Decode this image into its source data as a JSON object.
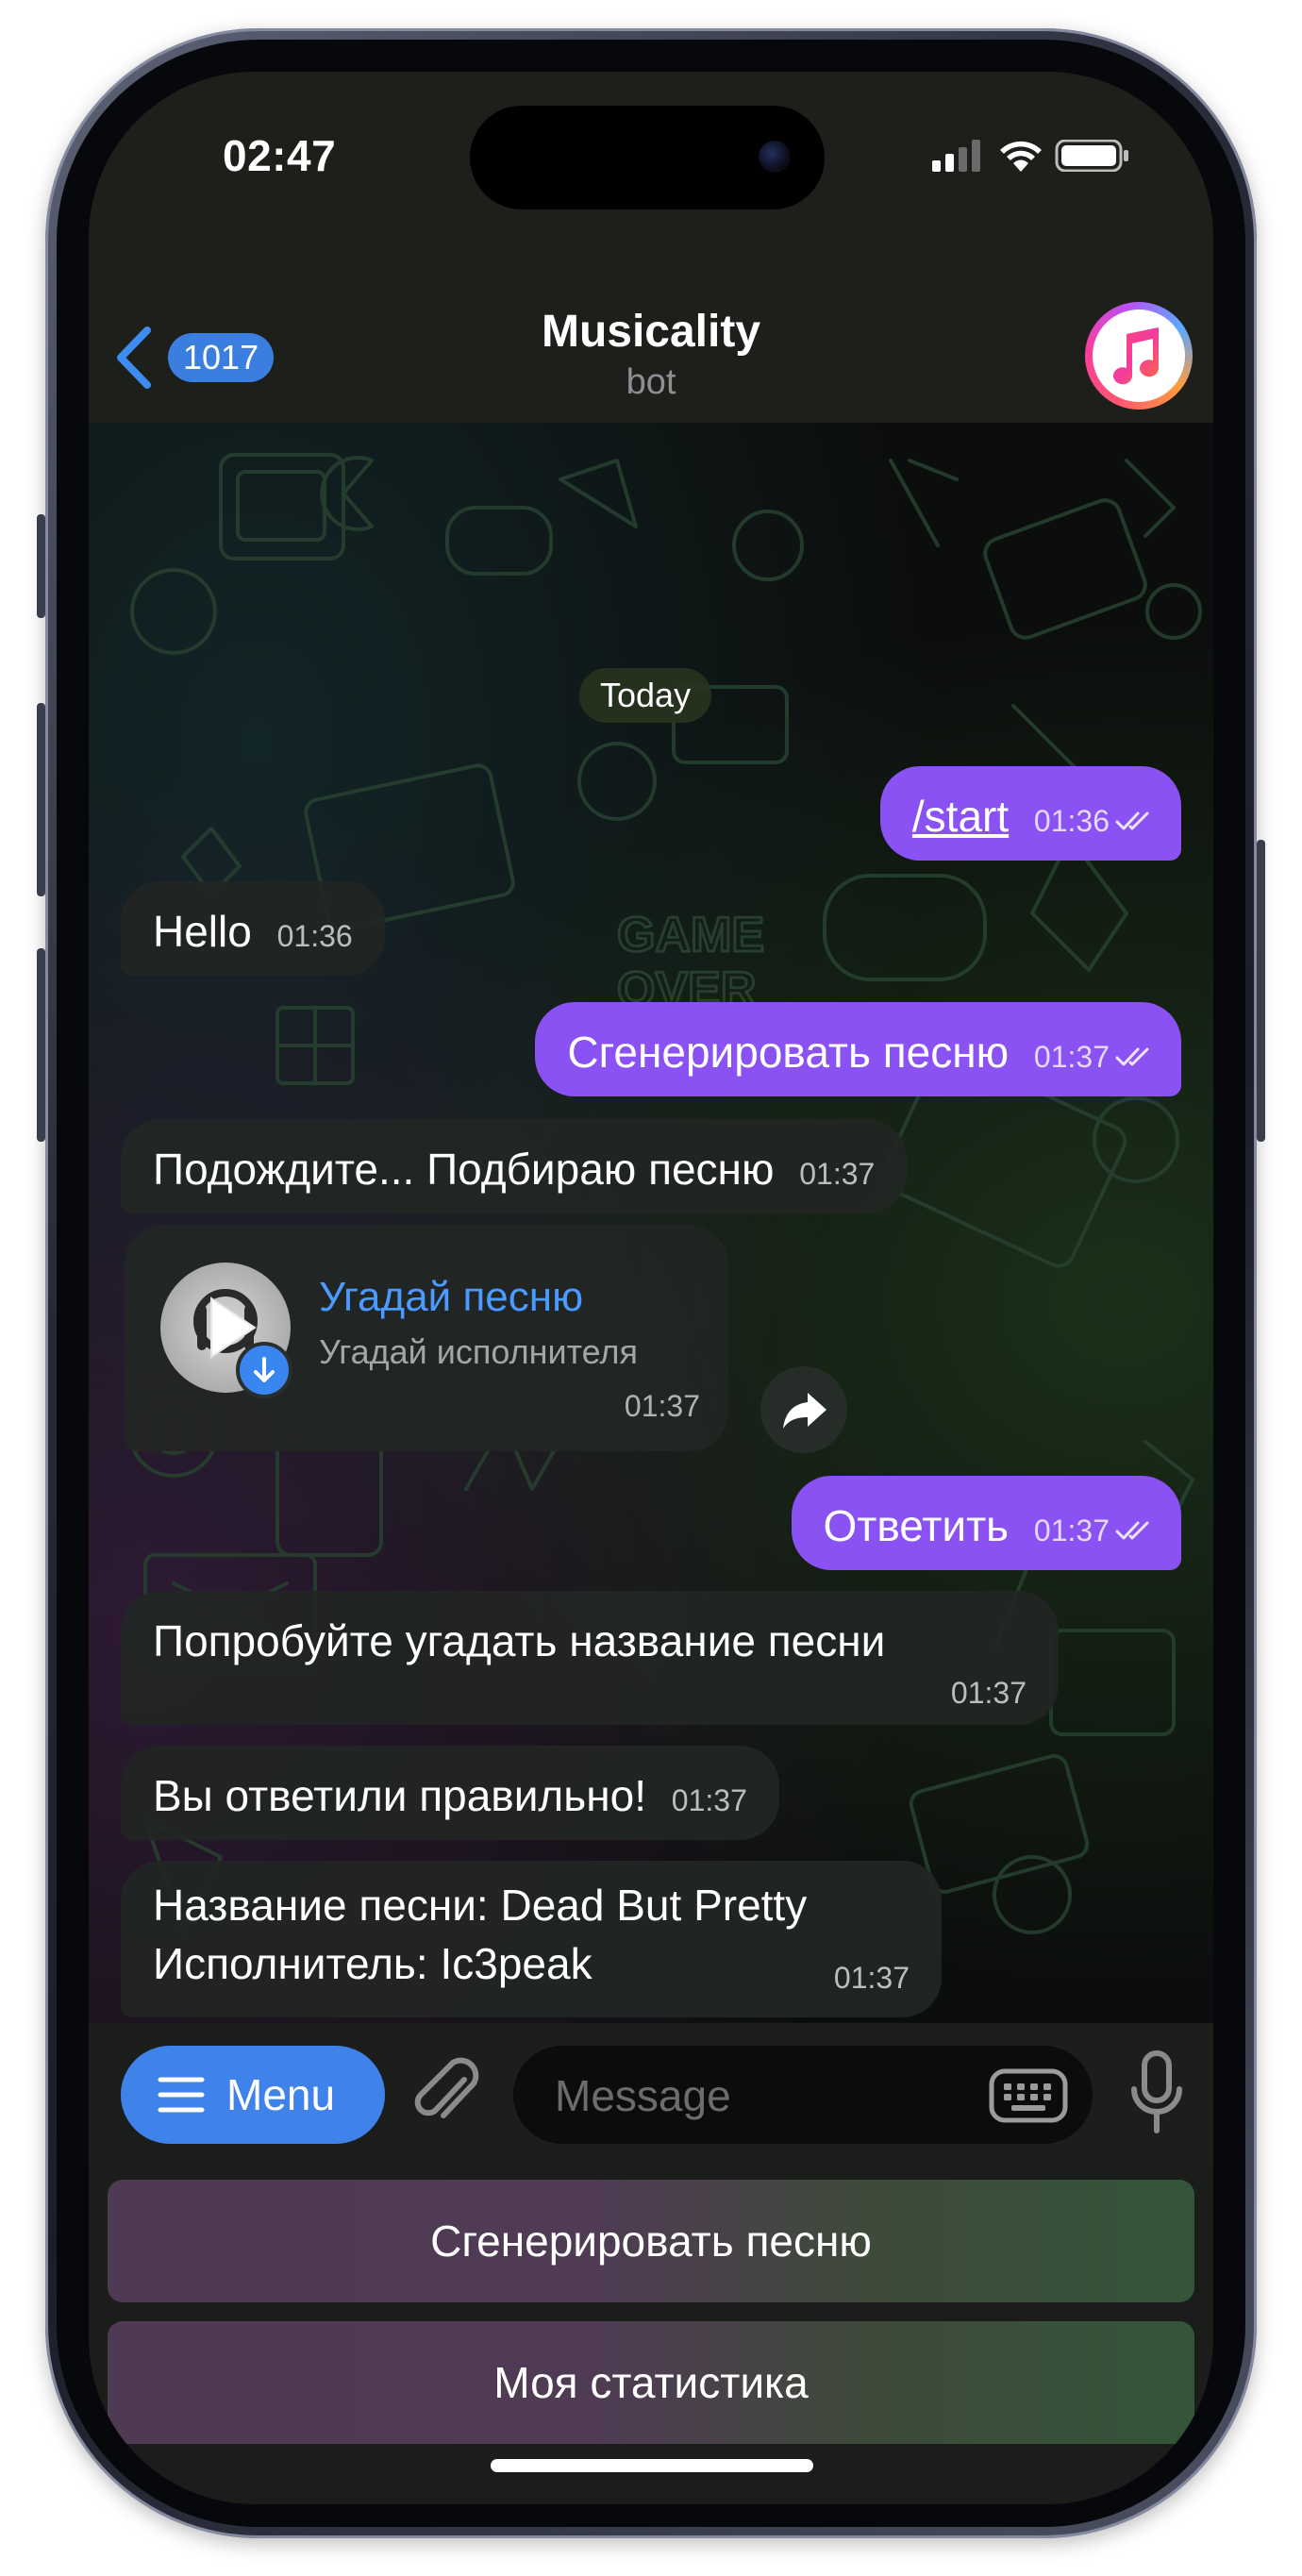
{
  "status_bar": {
    "time": "02:47"
  },
  "header": {
    "back_count": "1017",
    "title": "Musicality",
    "subtitle": "bot",
    "avatar_icon": "music-note-icon"
  },
  "chat": {
    "date_label": "Today",
    "messages": [
      {
        "text": "/start",
        "time": "01:36"
      },
      {
        "text": "Hello",
        "time": "01:36"
      },
      {
        "text": "Сгенерировать песню",
        "time": "01:37"
      },
      {
        "text": "Подождите... Подбираю песню",
        "time": "01:37"
      },
      {
        "text": "Ответить",
        "time": "01:37"
      },
      {
        "text": "Попробуйте угадать название песни",
        "time": "01:37"
      },
      {
        "text": "Вы ответили правильно!",
        "time": "01:37"
      },
      {
        "line1": "Название песни: Dead But Pretty",
        "line2": "Исполнитель: Ic3peak",
        "time": "01:37"
      }
    ],
    "audio": {
      "title": "Угадай песню",
      "artist": "Угадай исполнителя",
      "time": "01:37"
    }
  },
  "input_bar": {
    "menu_label": "Menu",
    "placeholder": "Message"
  },
  "keyboard": {
    "buttons": [
      "Сгенерировать песню",
      "Моя статистика"
    ]
  },
  "colors": {
    "outgoing_bubble": "#8a52f2",
    "accent_blue": "#3f82ea",
    "incoming_bubble": "#222624"
  }
}
